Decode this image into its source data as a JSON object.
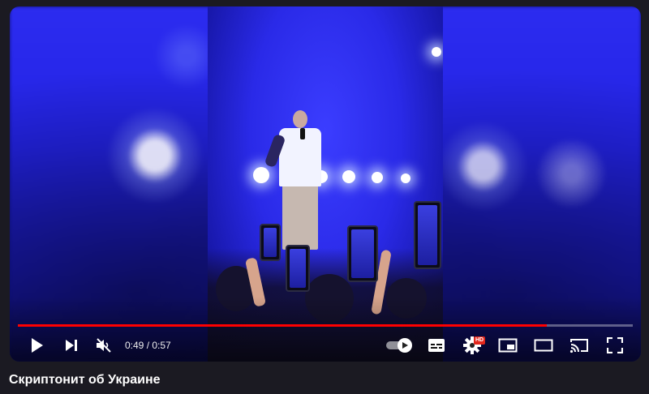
{
  "video": {
    "title": "Скриптонит об Украине",
    "time_current": "0:49",
    "time_separator": " / ",
    "time_total": "0:57",
    "progress_fraction": 0.86
  },
  "controls": {
    "play_icon": "play-icon",
    "next_icon": "next-icon",
    "mute_icon": "muted-volume-icon",
    "autoplay_icon": "autoplay-toggle-icon",
    "subtitles_icon": "subtitles-icon",
    "settings_icon": "gear-icon",
    "settings_badge": "HD",
    "miniplayer_icon": "miniplayer-icon",
    "theater_icon": "theater-mode-icon",
    "cast_icon": "cast-icon",
    "fullscreen_icon": "fullscreen-icon"
  },
  "colors": {
    "progress": "#ff0000",
    "badge": "#e3261c",
    "stage_blue": "#2a2ae8"
  }
}
